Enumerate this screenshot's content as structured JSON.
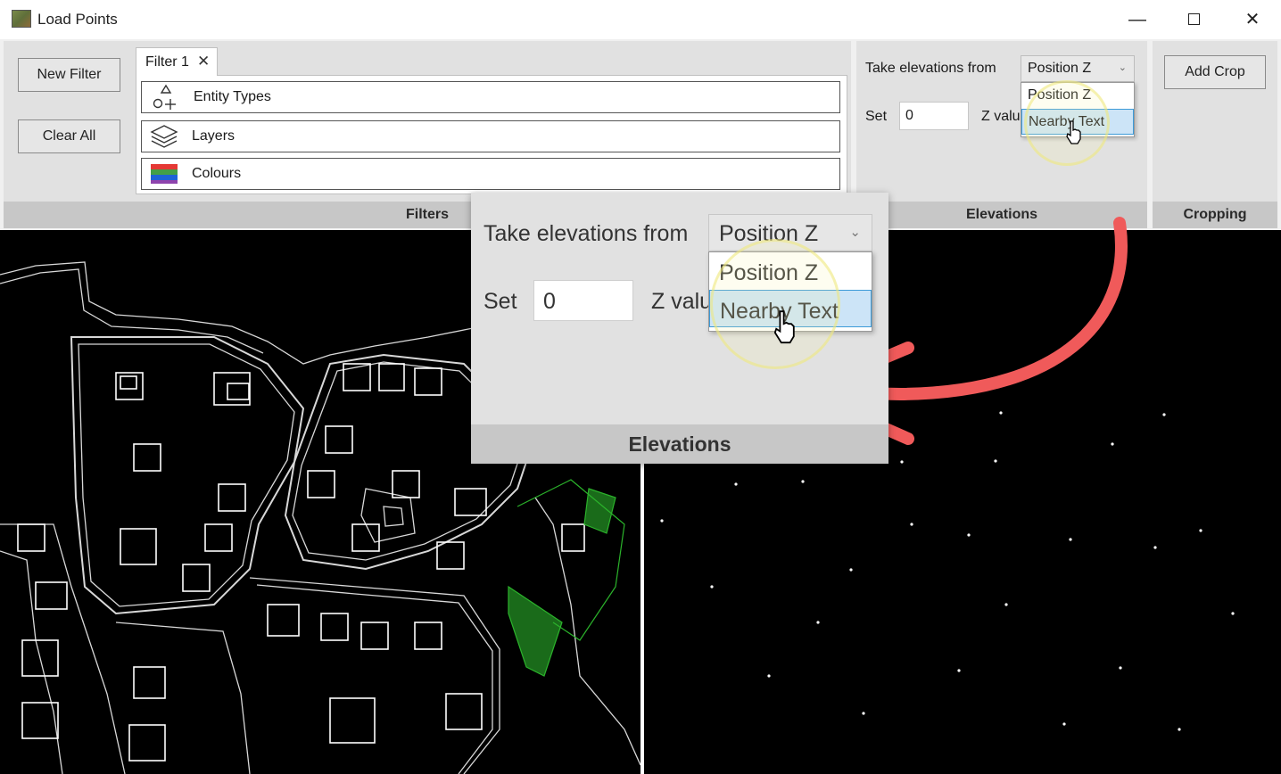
{
  "window": {
    "title": "Load Points",
    "minimize": "—",
    "close": "✕"
  },
  "filters_group": {
    "new_filter": "New Filter",
    "clear_all": "Clear All",
    "tab_label": "Filter 1",
    "tab_close": "✕",
    "rows": [
      {
        "label": "Entity Types",
        "icon": "entity-types-icon"
      },
      {
        "label": "Layers",
        "icon": "layers-icon"
      },
      {
        "label": "Colours",
        "icon": "colours-icon"
      }
    ],
    "group_label": "Filters"
  },
  "elevations_group": {
    "take_label": "Take elevations from",
    "selected_value": "Position Z",
    "options": [
      "Position Z",
      "Nearby Text"
    ],
    "highlighted_option": "Nearby Text",
    "set_label": "Set",
    "set_value": "0",
    "zvalue_label": "Z value",
    "group_label": "Elevations"
  },
  "cropping_group": {
    "add_crop": "Add Crop",
    "group_label": "Cropping"
  },
  "colors": {
    "ribbon_bg": "#e1e1e1",
    "group_label_bg": "#c7c7c7",
    "selection": "#cce4f7",
    "selection_border": "#3d9bd8",
    "arrow": "#f05a5a",
    "highlight_ring": "#ece878"
  }
}
